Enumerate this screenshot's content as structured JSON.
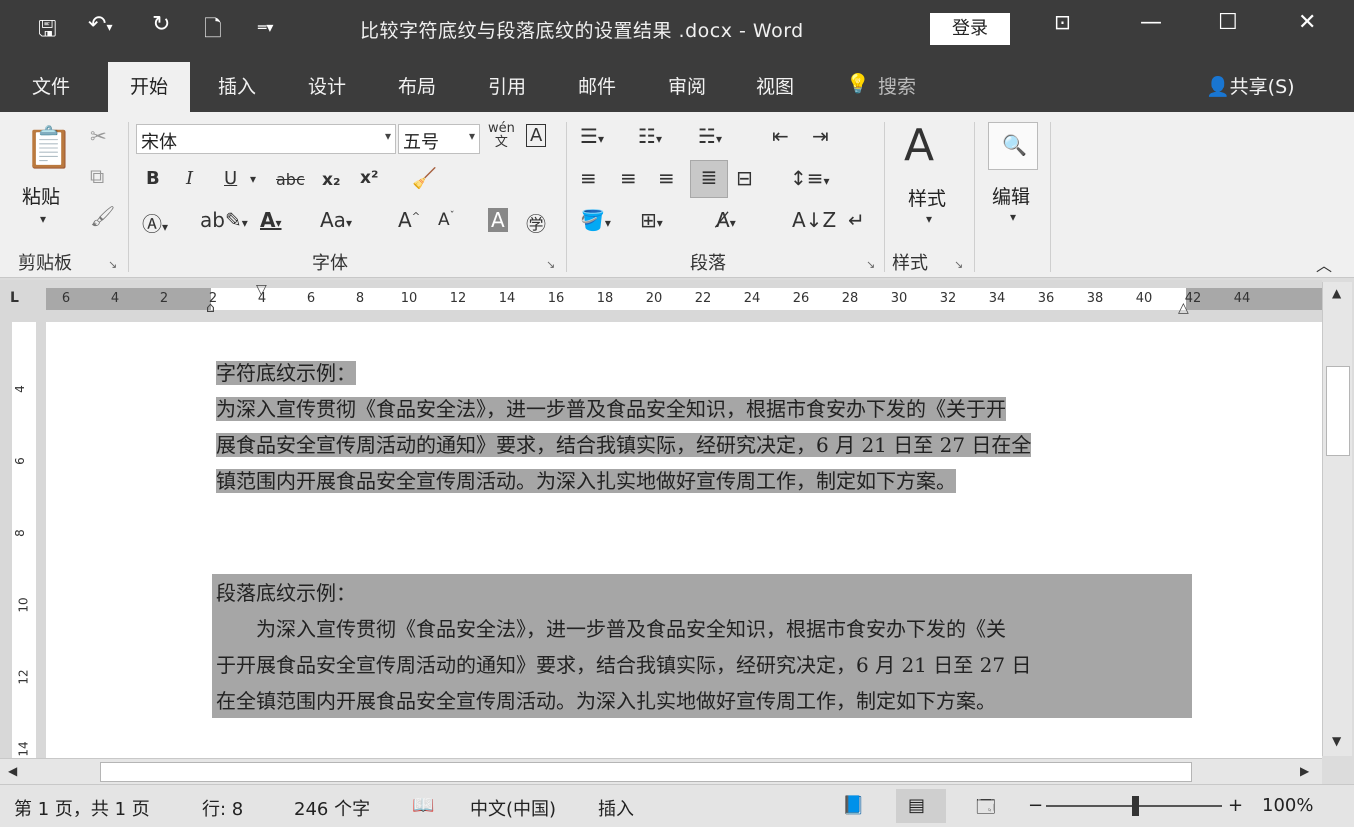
{
  "title_bar": {
    "title": "比较字符底纹与段落底纹的设置结果 .docx  -  Word",
    "login_label": "登录",
    "quick_access": [
      "save-icon",
      "undo-icon",
      "redo-icon",
      "new-doc-icon",
      "customize-icon"
    ]
  },
  "tabs": {
    "file": "文件",
    "home": "开始",
    "insert": "插入",
    "design": "设计",
    "layout": "布局",
    "references": "引用",
    "mailings": "邮件",
    "review": "审阅",
    "view": "视图",
    "search": "搜索",
    "share": "共享(S)"
  },
  "ribbon": {
    "clipboard": {
      "paste_label": "粘贴",
      "group_label": "剪贴板"
    },
    "font": {
      "font_name": "宋体",
      "font_size": "五号",
      "phonetic": "wén",
      "phonetic_sub": "文",
      "bold": "B",
      "italic": "I",
      "underline": "U",
      "strikethrough": "abc",
      "subscript": "x₂",
      "superscript": "x²",
      "change_case": "Aa",
      "group_label": "字体"
    },
    "paragraph": {
      "group_label": "段落"
    },
    "styles": {
      "label": "样式",
      "group_label": "样式"
    },
    "editing": {
      "label": "编辑"
    }
  },
  "ruler": {
    "ticks": [
      "6",
      "4",
      "2",
      "2",
      "4",
      "6",
      "8",
      "10",
      "12",
      "14",
      "16",
      "18",
      "20",
      "22",
      "24",
      "26",
      "28",
      "30",
      "32",
      "34",
      "36",
      "38",
      "40",
      "42",
      "44"
    ],
    "vticks": [
      "4",
      "6",
      "8",
      "10",
      "12",
      "14"
    ]
  },
  "document": {
    "char_shading_heading": "字符底纹示例：",
    "char_lines": [
      "为深入宣传贯彻《食品安全法》，进一步普及食品安全知识，根据市食安办下发的《关于开",
      "展食品安全宣传周活动的通知》要求，结合我镇实际，经研究决定，6 月 21 日至 27 日在全",
      "镇范围内开展食品安全宣传周活动。为深入扎实地做好宣传周工作，制定如下方案。"
    ],
    "para_shading_heading": "段落底纹示例：",
    "para_lines": [
      "　　为深入宣传贯彻《食品安全法》，进一步普及食品安全知识，根据市食安办下发的《关",
      "于开展食品安全宣传周活动的通知》要求，结合我镇实际，经研究决定，6 月 21 日至 27 日",
      "在全镇范围内开展食品安全宣传周活动。为深入扎实地做好宣传周工作，制定如下方案。"
    ]
  },
  "status_bar": {
    "page": "第 1 页，共 1 页",
    "line": "行: 8",
    "words": "246 个字",
    "language": "中文(中国)",
    "mode": "插入",
    "zoom": "100%"
  },
  "colors": {
    "title_bg": "#3c3c3c",
    "ribbon_bg": "#f0f0f0",
    "shading": "#a6a6a6"
  }
}
